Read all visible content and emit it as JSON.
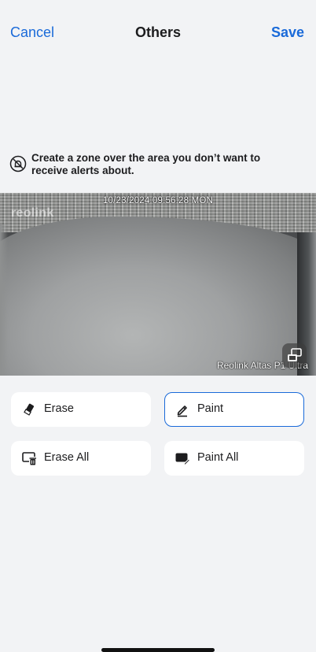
{
  "nav": {
    "cancel_label": "Cancel",
    "title": "Others",
    "save_label": "Save"
  },
  "hint": {
    "icon": "no-alert-icon",
    "text": "Create a zone over the area you don’t want to receive alerts about."
  },
  "camera": {
    "timestamp": "10/23/2024 09:56:28 MON",
    "logo": "reolink",
    "model": "Reolink Altas P1 Ultra",
    "switch_icon": "switch-view-icon"
  },
  "tools": [
    {
      "label": "Erase",
      "icon": "eraser-icon",
      "selected": false
    },
    {
      "label": "Paint",
      "icon": "pen-icon",
      "selected": true
    },
    {
      "label": "Erase All",
      "icon": "erase-all-icon",
      "selected": false
    },
    {
      "label": "Paint All",
      "icon": "paint-all-icon",
      "selected": false
    }
  ],
  "colors": {
    "accent": "#1a6ad9",
    "background": "#f2f3f5",
    "button": "#ffffff"
  }
}
